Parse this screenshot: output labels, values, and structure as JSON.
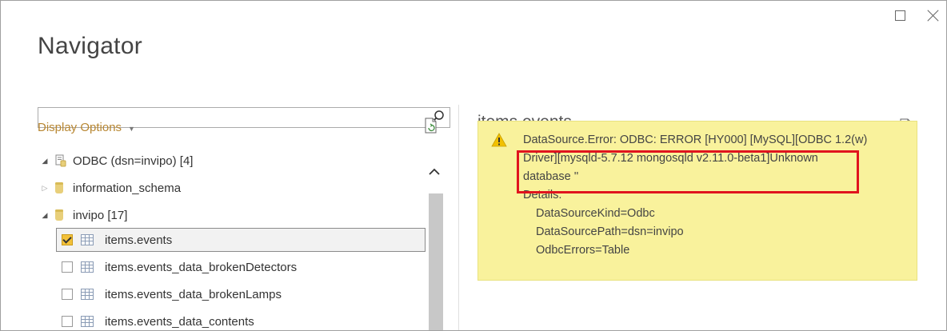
{
  "window": {
    "title": "Navigator"
  },
  "search": {
    "value": "",
    "placeholder": ""
  },
  "display_options": {
    "label": "Display Options"
  },
  "tree": {
    "root": {
      "label": "ODBC (dsn=invipo) [4]"
    },
    "databases": [
      {
        "label": "information_schema",
        "expanded": false
      },
      {
        "label": "invipo [17]",
        "expanded": true
      }
    ],
    "tables": [
      {
        "label": "items.events",
        "checked": true
      },
      {
        "label": "items.events_data_brokenDetectors",
        "checked": false
      },
      {
        "label": "items.events_data_brokenLamps",
        "checked": false
      },
      {
        "label": "items.events_data_contents",
        "checked": false
      }
    ]
  },
  "preview": {
    "title": "items.events",
    "error": {
      "lines": [
        "DataSource.Error: ODBC: ERROR [HY000] [MySQL][ODBC 1.2(w)",
        "Driver][mysqld-5.7.12 mongosqld v2.11.0-beta1]Unknown",
        "database ''"
      ],
      "details_label": "Details:",
      "details": [
        "DataSourceKind=Odbc",
        "DataSourcePath=dsn=invipo",
        "OdbcErrors=Table"
      ]
    }
  },
  "colors": {
    "display_options": "#b88732",
    "error_background": "#f9f29c",
    "highlight_border": "#e0141e",
    "checkbox_checked": "#f3c13a"
  },
  "icons": {
    "search": "search-icon",
    "refresh": "refresh-icon",
    "warning": "warning-icon",
    "database": "database-icon",
    "table": "table-icon"
  }
}
